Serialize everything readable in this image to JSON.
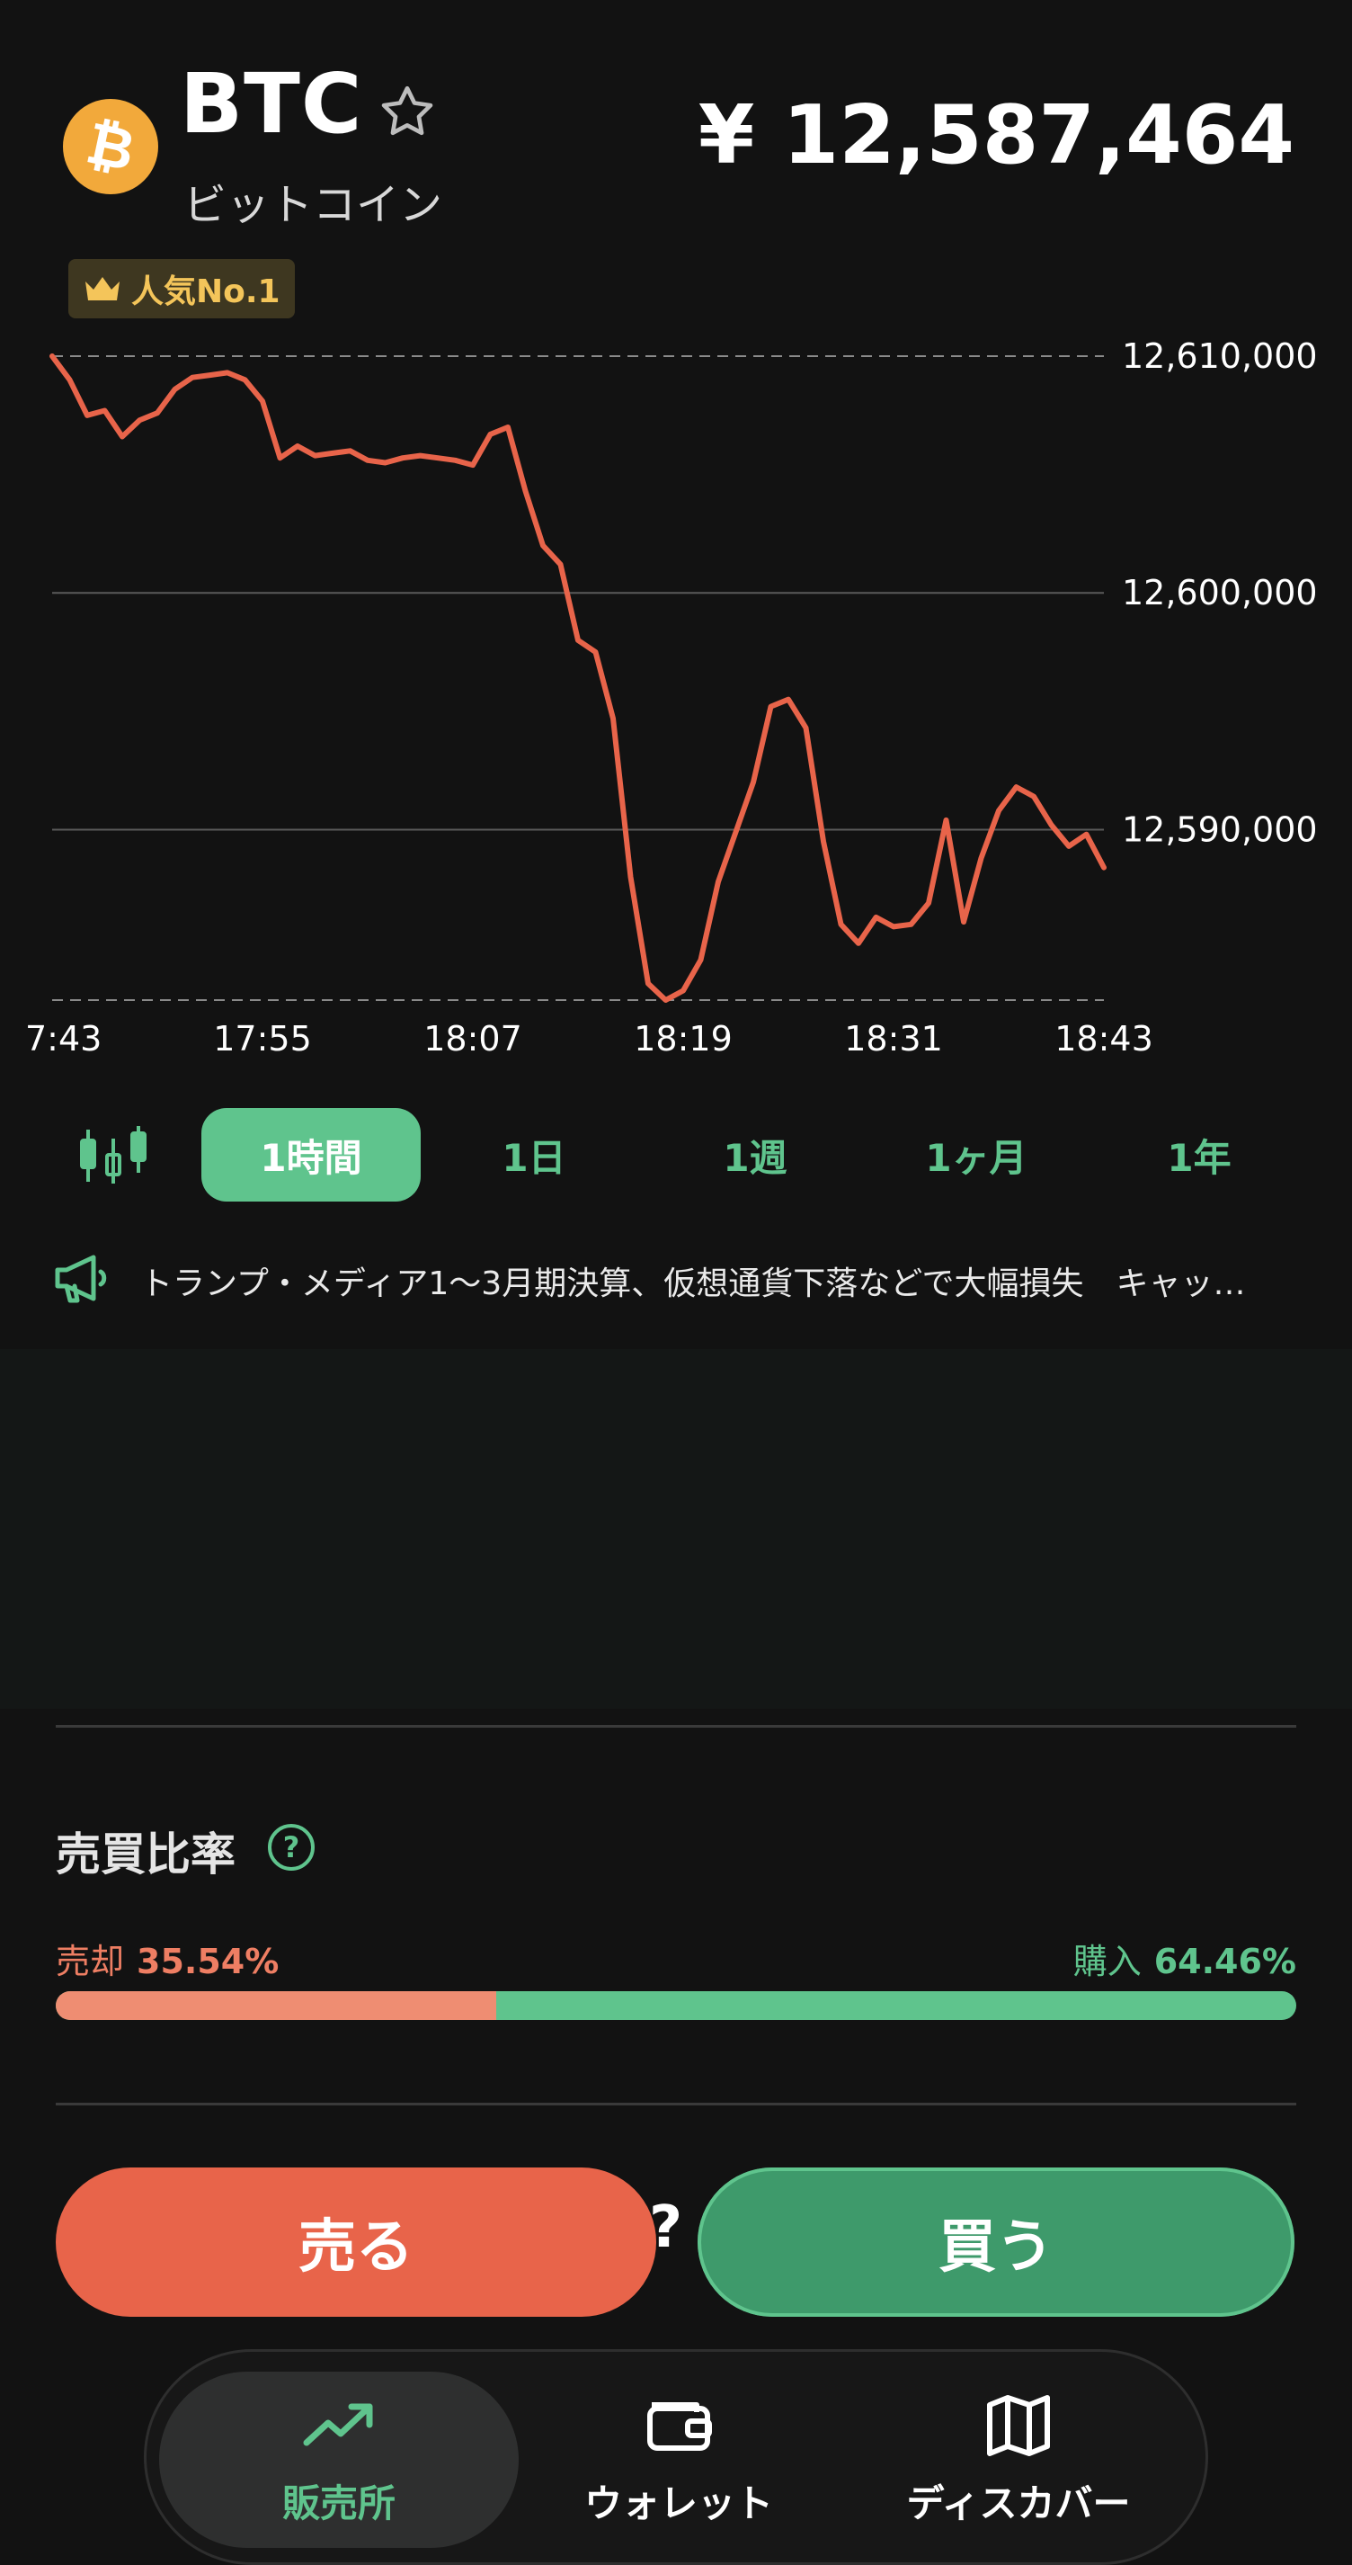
{
  "header": {
    "symbol": "BTC",
    "name": "ビットコイン",
    "price": "¥ 12,587,464",
    "badge": "人気No.1",
    "logo_glyph": "₿",
    "colors": {
      "logo": "#f2a93b",
      "badge_text": "#f4c55a"
    }
  },
  "chart_data": {
    "type": "line",
    "x": [
      "17:43",
      "17:44",
      "17:45",
      "17:46",
      "17:47",
      "17:48",
      "17:49",
      "17:50",
      "17:51",
      "17:52",
      "17:53",
      "17:54",
      "17:55",
      "17:56",
      "17:57",
      "17:58",
      "17:59",
      "18:00",
      "18:01",
      "18:02",
      "18:03",
      "18:04",
      "18:05",
      "18:06",
      "18:07",
      "18:08",
      "18:09",
      "18:10",
      "18:11",
      "18:12",
      "18:13",
      "18:14",
      "18:15",
      "18:16",
      "18:17",
      "18:18",
      "18:19",
      "18:20",
      "18:21",
      "18:22",
      "18:23",
      "18:24",
      "18:25",
      "18:26",
      "18:27",
      "18:28",
      "18:29",
      "18:30",
      "18:31",
      "18:32",
      "18:33",
      "18:34",
      "18:35",
      "18:36",
      "18:37",
      "18:38",
      "18:39",
      "18:40",
      "18:41",
      "18:42",
      "18:43"
    ],
    "series": [
      {
        "values": [
          12610000,
          12609000,
          12607500,
          12607700,
          12606600,
          12607300,
          12607600,
          12608600,
          12609100,
          12609200,
          12609300,
          12609000,
          12608100,
          12605700,
          12606200,
          12605800,
          12605900,
          12606000,
          12605600,
          12605500,
          12605700,
          12605800,
          12605700,
          12605600,
          12605400,
          12606700,
          12607000,
          12604300,
          12602000,
          12601200,
          12598000,
          12597500,
          12594700,
          12588000,
          12583500,
          12582800,
          12583200,
          12584500,
          12587800,
          12589900,
          12592000,
          12595200,
          12595500,
          12594300,
          12589500,
          12586000,
          12585200,
          12586300,
          12585900,
          12586000,
          12586900,
          12590400,
          12586100,
          12588800,
          12590800,
          12591800,
          12591400,
          12590200,
          12589300,
          12589800,
          12588400
        ]
      }
    ],
    "y_ticks": [
      "12,610,000",
      "12,600,000",
      "12,590,000"
    ],
    "x_ticks": [
      "7:43",
      "17:55",
      "18:07",
      "18:19",
      "18:31",
      "18:43"
    ],
    "ylim": [
      12582800,
      12610000
    ],
    "max_value": 12610000,
    "min_value": 12582800,
    "grid": true,
    "colors": {
      "line": "#e8644a",
      "grid": "#5a5a5a",
      "tick_label": "#ffffff"
    }
  },
  "tabs": {
    "items": [
      "1時間",
      "1日",
      "1週",
      "1ヶ月",
      "1年"
    ],
    "active_index": 0
  },
  "news": {
    "text": "トランプ・メディア1〜3月期決算、仮想通貨下落などで大幅損失　キャッ…"
  },
  "ratio": {
    "title": "売買比率",
    "sell_label": "売却",
    "sell_value": "35.54%",
    "buy_label": "購入",
    "buy_value": "64.46%",
    "sell_fraction": 0.3554,
    "colors": {
      "sell": "#ef8d72",
      "buy": "#5fc48d"
    }
  },
  "actions": {
    "sell": "売る",
    "buy": "買う",
    "help": "?"
  },
  "nav": {
    "items": [
      "販売所",
      "ウォレット",
      "ディスカバー"
    ],
    "icons": [
      "trending-up-icon",
      "wallet-icon",
      "map-icon"
    ],
    "active_index": 0
  }
}
